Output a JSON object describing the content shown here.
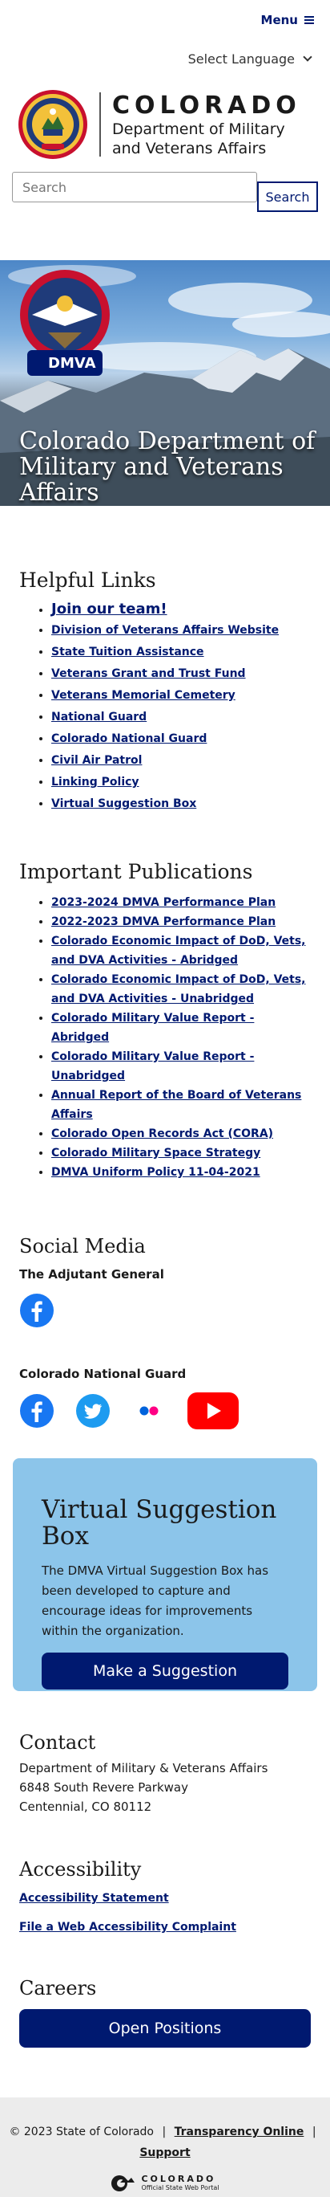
{
  "header": {
    "menu_label": "Menu",
    "language_label": "Select Language",
    "logo_title": "COLORADO",
    "logo_dept_line1": "Department of Military",
    "logo_dept_line2": "and Veterans Affairs",
    "search_placeholder": "Search",
    "search_button": "Search"
  },
  "hero": {
    "title": "Colorado Department of Military and Veterans Affairs",
    "badge_text": "DMVA"
  },
  "helpful_links": {
    "heading": "Helpful Links",
    "items": [
      "Join our team!",
      "Division of Veterans Affairs Website",
      "State Tuition Assistance",
      "Veterans Grant and Trust Fund",
      "Veterans Memorial Cemetery",
      "National Guard",
      "Colorado National Guard",
      "Civil Air Patrol",
      "Linking Policy",
      "Virtual Suggestion Box"
    ]
  },
  "publications": {
    "heading": "Important Publications",
    "items": [
      "2023-2024 DMVA Performance Plan",
      "2022-2023 DMVA Performance Plan",
      "Colorado Economic Impact of DoD, Vets, and DVA Activities - Abridged",
      "Colorado Economic Impact of DoD, Vets, and DVA Activities - Unabridged",
      "Colorado Military Value Report - Abridged",
      "Colorado Military Value Report - Unabridged",
      "Annual Report of the Board of Veterans Affairs",
      "Colorado Open Records Act (CORA)",
      "Colorado Military Space Strategy",
      "DMVA Uniform Policy 11-04-2021"
    ]
  },
  "social": {
    "heading": "Social Media",
    "group1": "The Adjutant General",
    "group2": "Colorado National Guard",
    "icons": [
      "facebook-icon",
      "facebook-icon",
      "twitter-icon",
      "flickr-icon",
      "youtube-icon"
    ],
    "colors": {
      "facebook": "#1877f2",
      "twitter": "#1d9bf0",
      "flickr_blue": "#0063dc",
      "flickr_pink": "#ff0084",
      "youtube": "#ff0000"
    }
  },
  "suggestion": {
    "heading": "Virtual Suggestion Box",
    "body": "The DMVA Virtual Suggestion Box has been developed to capture and encourage ideas for improvements within the organization.",
    "button": "Make a Suggestion"
  },
  "contact": {
    "heading": "Contact",
    "line1": "Department of Military & Veterans Affairs",
    "line2": "6848 South Revere Parkway",
    "line3": "Centennial, CO 80112"
  },
  "accessibility": {
    "heading": "Accessibility",
    "link1": "Accessibility Statement",
    "link2": "File a Web Accessibility Complaint"
  },
  "careers": {
    "heading": "Careers",
    "button": "Open Positions"
  },
  "footer": {
    "copyright": "© 2023 State of Colorado",
    "sep": "|",
    "transparency": "Transparency Online",
    "support": "Support",
    "logo_title": "COLORADO",
    "logo_sub": "Official State Web Portal"
  },
  "colors": {
    "navy": "#001970",
    "suggestion_bg": "#8cc5ea",
    "footer_bg": "#ececec"
  }
}
